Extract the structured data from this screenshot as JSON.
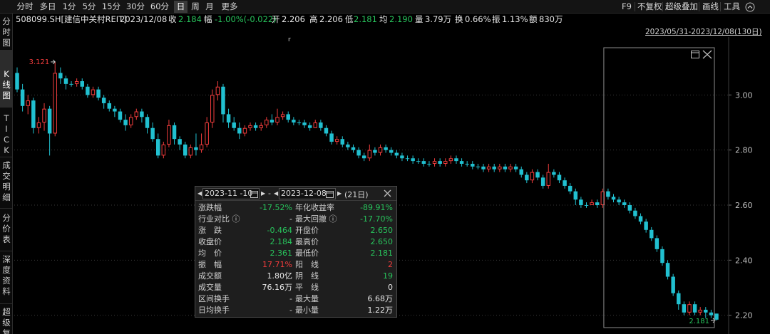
{
  "toolbar": {
    "period_tabs": [
      {
        "label": "分时",
        "active": false
      },
      {
        "label": "多日",
        "active": false
      },
      {
        "label": "1分",
        "active": false
      },
      {
        "label": "5分",
        "active": false
      },
      {
        "label": "15分",
        "active": false
      },
      {
        "label": "30分",
        "active": false
      },
      {
        "label": "60分",
        "active": false
      },
      {
        "label": "日",
        "active": true
      },
      {
        "label": "周",
        "active": false
      },
      {
        "label": "月",
        "active": false
      },
      {
        "label": "更多",
        "active": false
      }
    ],
    "right_tools": [
      "F9",
      "不复权",
      "超级叠加",
      "画线",
      "工具"
    ],
    "collapse_icon": "chevron-up-icon"
  },
  "info": {
    "security": "508099.SH[建信中关村REIT]",
    "date": "2023/12/08",
    "close_label": "收",
    "close_value": "2.184",
    "change_label": "幅",
    "change_value": "-1.00%(-0.022)",
    "open_label": "开",
    "open_value": "2.206",
    "high_label": "高",
    "high_value": "2.206",
    "low_label": "低",
    "low_value": "2.181",
    "avg_label": "均",
    "avg_value": "2.190",
    "volume_label": "量",
    "volume_value": "3.79万",
    "turnover_label": "换",
    "turnover_value": "0.66%",
    "amplitude_label": "振",
    "amplitude_value": "1.13%",
    "amount_label": "额",
    "amount_value": "830万"
  },
  "sidebar": [
    {
      "label": "分\n时\n图",
      "active": false
    },
    {
      "label": "K\n线\n图",
      "active": true
    },
    {
      "label": "T\nI\nC\nK",
      "active": false
    },
    {
      "label": "成\n交\n明\n细",
      "active": false
    },
    {
      "label": "分\n价\n表",
      "active": false
    },
    {
      "label": "深\n度\n资\n料",
      "active": false
    },
    {
      "label": "超\n级\n复\n盘",
      "active": false
    }
  ],
  "colors": {
    "up": "#f03c3c",
    "down": "#21c0d0",
    "green_text": "#28c45c",
    "background": "#000000",
    "grid": "#3a3a3a"
  },
  "popup": {
    "start_date": "2023-11 -10",
    "end_date": "2023-12-08",
    "days": "(21日)",
    "rows": [
      {
        "l1": "涨跌幅",
        "v1": "-17.52%",
        "c1": "green",
        "l2": "年化收益率",
        "v2": "-89.91%",
        "c2": "green"
      },
      {
        "l1": "行业对比 ⓘ",
        "v1": "-",
        "c1": "gray",
        "l2": "最大回撤 ⓘ",
        "v2": "-17.70%",
        "c2": "green"
      },
      {
        "l1": "涨　跌",
        "v1": "-0.464",
        "c1": "green",
        "l2": "开盘价",
        "v2": "2.650",
        "c2": "green"
      },
      {
        "l1": "收盘价",
        "v1": "2.184",
        "c1": "green",
        "l2": "最高价",
        "v2": "2.650",
        "c2": "green"
      },
      {
        "l1": "均　价",
        "v1": "2.361",
        "c1": "green",
        "l2": "最低价",
        "v2": "2.181",
        "c2": "green"
      },
      {
        "l1": "振　幅",
        "v1": "17.71%",
        "c1": "red",
        "l2": "阳　线",
        "v2": "2",
        "c2": "red"
      },
      {
        "l1": "成交额",
        "v1": "1.80亿",
        "c1": "white",
        "l2": "阴　线",
        "v2": "19",
        "c2": "green"
      },
      {
        "l1": "成交量",
        "v1": "76.16万",
        "c1": "white",
        "l2": "平　线",
        "v2": "0",
        "c2": "white"
      },
      {
        "l1": "区间换手",
        "v1": "-",
        "c1": "gray",
        "l2": "最大量",
        "v2": "6.68万",
        "c2": "white"
      },
      {
        "l1": "日均换手",
        "v1": "-",
        "c1": "gray",
        "l2": "最小量",
        "v2": "1.22万",
        "c2": "white"
      }
    ]
  },
  "chart_data": {
    "type": "candlestick",
    "title": "",
    "range_label": "2023/05/31-2023/12/08(130日)",
    "ylim": [
      2.15,
      3.2
    ],
    "y_ticks": [
      "3.00",
      "2.80",
      "2.60",
      "2.40",
      "2.20"
    ],
    "high_marker": "3.121",
    "low_marker": "2.181",
    "grid": true,
    "candles": [
      [
        3.08,
        3.02,
        3.1,
        3.01
      ],
      [
        3.02,
        2.96,
        3.04,
        2.94
      ],
      [
        2.96,
        2.98,
        3.0,
        2.93
      ],
      [
        2.98,
        2.88,
        2.99,
        2.86
      ],
      [
        2.88,
        2.9,
        2.92,
        2.86
      ],
      [
        2.9,
        2.95,
        2.97,
        2.87
      ],
      [
        2.95,
        2.86,
        2.96,
        2.78
      ],
      [
        2.86,
        3.08,
        3.12,
        2.85
      ],
      [
        3.08,
        3.06,
        3.1,
        3.04
      ],
      [
        3.06,
        3.04,
        3.07,
        3.02
      ],
      [
        3.04,
        3.04,
        3.05,
        3.03
      ],
      [
        3.04,
        3.05,
        3.06,
        3.03
      ],
      [
        3.05,
        3.03,
        3.06,
        3.02
      ],
      [
        3.03,
        3.0,
        3.04,
        2.99
      ],
      [
        3.0,
        3.02,
        3.03,
        2.99
      ],
      [
        3.02,
        2.99,
        3.03,
        2.98
      ],
      [
        2.99,
        2.97,
        3.0,
        2.95
      ],
      [
        2.97,
        2.95,
        2.98,
        2.94
      ],
      [
        2.95,
        2.94,
        2.96,
        2.92
      ],
      [
        2.94,
        2.91,
        2.95,
        2.9
      ],
      [
        2.91,
        2.89,
        2.93,
        2.87
      ],
      [
        2.89,
        2.92,
        2.93,
        2.88
      ],
      [
        2.92,
        2.94,
        2.95,
        2.91
      ],
      [
        2.94,
        2.92,
        2.95,
        2.9
      ],
      [
        2.92,
        2.88,
        2.93,
        2.86
      ],
      [
        2.88,
        2.84,
        2.9,
        2.83
      ],
      [
        2.84,
        2.78,
        2.86,
        2.77
      ],
      [
        2.78,
        2.82,
        2.83,
        2.77
      ],
      [
        2.82,
        2.89,
        2.91,
        2.81
      ],
      [
        2.89,
        2.84,
        2.9,
        2.82
      ],
      [
        2.84,
        2.82,
        2.85,
        2.8
      ],
      [
        2.82,
        2.78,
        2.83,
        2.77
      ],
      [
        2.78,
        2.81,
        2.82,
        2.77
      ],
      [
        2.81,
        2.8,
        2.86,
        2.78
      ],
      [
        2.8,
        2.82,
        2.86,
        2.79
      ],
      [
        2.82,
        2.9,
        2.92,
        2.81
      ],
      [
        2.9,
        3.0,
        3.02,
        2.88
      ],
      [
        3.0,
        3.03,
        3.05,
        2.98
      ],
      [
        3.03,
        2.93,
        3.04,
        2.9
      ],
      [
        2.93,
        2.9,
        2.95,
        2.88
      ],
      [
        2.9,
        2.88,
        2.92,
        2.87
      ],
      [
        2.88,
        2.86,
        2.9,
        2.84
      ],
      [
        2.86,
        2.88,
        2.89,
        2.85
      ],
      [
        2.88,
        2.89,
        2.9,
        2.87
      ],
      [
        2.89,
        2.88,
        2.9,
        2.87
      ],
      [
        2.88,
        2.89,
        2.9,
        2.87
      ],
      [
        2.89,
        2.91,
        2.92,
        2.88
      ],
      [
        2.91,
        2.9,
        2.93,
        2.89
      ],
      [
        2.9,
        2.92,
        2.95,
        2.89
      ],
      [
        2.92,
        2.93,
        2.94,
        2.91
      ],
      [
        2.93,
        2.91,
        2.94,
        2.9
      ],
      [
        2.91,
        2.9,
        2.92,
        2.89
      ],
      [
        2.9,
        2.9,
        2.91,
        2.89
      ],
      [
        2.9,
        2.89,
        2.91,
        2.88
      ],
      [
        2.89,
        2.88,
        2.9,
        2.87
      ],
      [
        2.88,
        2.9,
        2.91,
        2.88
      ],
      [
        2.9,
        2.88,
        2.91,
        2.87
      ],
      [
        2.88,
        2.86,
        2.89,
        2.85
      ],
      [
        2.86,
        2.83,
        2.87,
        2.82
      ],
      [
        2.83,
        2.84,
        2.85,
        2.82
      ],
      [
        2.84,
        2.82,
        2.85,
        2.81
      ],
      [
        2.82,
        2.81,
        2.83,
        2.8
      ],
      [
        2.81,
        2.8,
        2.82,
        2.79
      ],
      [
        2.8,
        2.78,
        2.81,
        2.77
      ],
      [
        2.78,
        2.77,
        2.79,
        2.76
      ],
      [
        2.77,
        2.8,
        2.82,
        2.76
      ],
      [
        2.8,
        2.79,
        2.81,
        2.78
      ],
      [
        2.79,
        2.81,
        2.82,
        2.78
      ],
      [
        2.81,
        2.8,
        2.82,
        2.79
      ],
      [
        2.8,
        2.79,
        2.81,
        2.78
      ],
      [
        2.79,
        2.78,
        2.8,
        2.77
      ],
      [
        2.78,
        2.77,
        2.79,
        2.76
      ],
      [
        2.77,
        2.77,
        2.78,
        2.76
      ],
      [
        2.77,
        2.76,
        2.78,
        2.75
      ],
      [
        2.76,
        2.76,
        2.77,
        2.75
      ],
      [
        2.76,
        2.75,
        2.77,
        2.74
      ],
      [
        2.75,
        2.75,
        2.76,
        2.74
      ],
      [
        2.75,
        2.76,
        2.77,
        2.74
      ],
      [
        2.76,
        2.75,
        2.77,
        2.74
      ],
      [
        2.75,
        2.76,
        2.77,
        2.74
      ],
      [
        2.76,
        2.77,
        2.78,
        2.75
      ],
      [
        2.77,
        2.76,
        2.78,
        2.75
      ],
      [
        2.76,
        2.75,
        2.77,
        2.74
      ],
      [
        2.75,
        2.75,
        2.76,
        2.74
      ],
      [
        2.75,
        2.74,
        2.76,
        2.73
      ],
      [
        2.74,
        2.74,
        2.75,
        2.73
      ],
      [
        2.74,
        2.73,
        2.75,
        2.72
      ],
      [
        2.73,
        2.74,
        2.75,
        2.72
      ],
      [
        2.74,
        2.73,
        2.75,
        2.72
      ],
      [
        2.73,
        2.74,
        2.75,
        2.72
      ],
      [
        2.74,
        2.73,
        2.75,
        2.72
      ],
      [
        2.73,
        2.74,
        2.75,
        2.72
      ],
      [
        2.74,
        2.73,
        2.75,
        2.72
      ],
      [
        2.73,
        2.71,
        2.74,
        2.7
      ],
      [
        2.71,
        2.69,
        2.72,
        2.68
      ],
      [
        2.69,
        2.72,
        2.73,
        2.68
      ],
      [
        2.72,
        2.7,
        2.73,
        2.69
      ],
      [
        2.7,
        2.67,
        2.71,
        2.66
      ],
      [
        2.67,
        2.72,
        2.75,
        2.66
      ],
      [
        2.72,
        2.71,
        2.73,
        2.7
      ],
      [
        2.71,
        2.69,
        2.72,
        2.68
      ],
      [
        2.69,
        2.67,
        2.7,
        2.66
      ],
      [
        2.67,
        2.65,
        2.68,
        2.64
      ],
      [
        2.65,
        2.62,
        2.66,
        2.6
      ],
      [
        2.62,
        2.6,
        2.63,
        2.59
      ],
      [
        2.6,
        2.6,
        2.61,
        2.59
      ],
      [
        2.6,
        2.61,
        2.62,
        2.6
      ],
      [
        2.61,
        2.6,
        2.62,
        2.59
      ],
      [
        2.6,
        2.65,
        2.66,
        2.59
      ],
      [
        2.65,
        2.63,
        2.66,
        2.62
      ],
      [
        2.63,
        2.62,
        2.64,
        2.61
      ],
      [
        2.62,
        2.61,
        2.63,
        2.6
      ],
      [
        2.61,
        2.6,
        2.62,
        2.59
      ],
      [
        2.6,
        2.58,
        2.61,
        2.57
      ],
      [
        2.58,
        2.56,
        2.59,
        2.55
      ],
      [
        2.56,
        2.54,
        2.57,
        2.53
      ],
      [
        2.54,
        2.51,
        2.55,
        2.5
      ],
      [
        2.51,
        2.48,
        2.52,
        2.47
      ],
      [
        2.48,
        2.44,
        2.49,
        2.43
      ],
      [
        2.44,
        2.39,
        2.45,
        2.38
      ],
      [
        2.39,
        2.34,
        2.4,
        2.33
      ],
      [
        2.34,
        2.28,
        2.35,
        2.27
      ],
      [
        2.28,
        2.24,
        2.29,
        2.22
      ],
      [
        2.24,
        2.21,
        2.25,
        2.2
      ],
      [
        2.21,
        2.24,
        2.25,
        2.2
      ],
      [
        2.24,
        2.21,
        2.25,
        2.2
      ],
      [
        2.21,
        2.22,
        2.23,
        2.2
      ],
      [
        2.22,
        2.21,
        2.23,
        2.19
      ],
      [
        2.21,
        2.2,
        2.22,
        2.19
      ],
      [
        2.206,
        2.184,
        2.206,
        2.181
      ]
    ]
  }
}
